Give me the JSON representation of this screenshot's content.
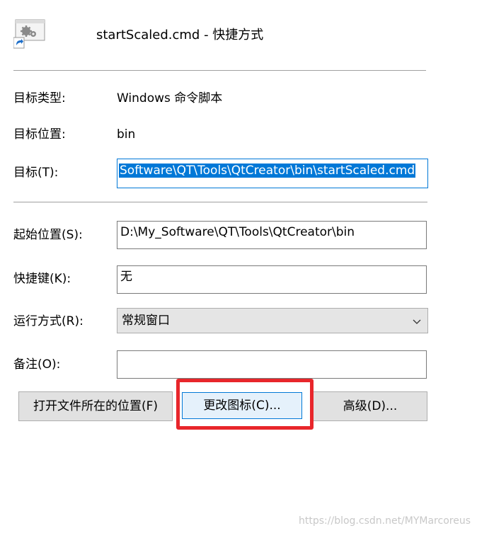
{
  "header": {
    "title": "startScaled.cmd - 快捷方式",
    "icon": "gear-shortcut-icon"
  },
  "properties": {
    "target_type_label": "目标类型:",
    "target_type_value": "Windows 命令脚本",
    "target_location_label": "目标位置:",
    "target_location_value": "bin",
    "target_label": "目标(T):",
    "target_value": "Software\\QT\\Tools\\QtCreator\\bin\\startScaled.cmd",
    "start_in_label": "起始位置(S):",
    "start_in_value": "D:\\My_Software\\QT\\Tools\\QtCreator\\bin",
    "hotkey_label": "快捷键(K):",
    "hotkey_value": "无",
    "run_label": "运行方式(R):",
    "run_value": "常规窗口",
    "comment_label": "备注(O):",
    "comment_value": ""
  },
  "buttons": {
    "open_location": "打开文件所在的位置(F)",
    "change_icon": "更改图标(C)...",
    "advanced": "高级(D)..."
  },
  "annotation": {
    "highlight_color": "#e8262b"
  },
  "watermark": "https://blog.csdn.net/MYMarcoreus",
  "colors": {
    "accent": "#0078d7",
    "button_bg": "#e1e1e1",
    "focused_button_bg": "#e5f1fb"
  }
}
